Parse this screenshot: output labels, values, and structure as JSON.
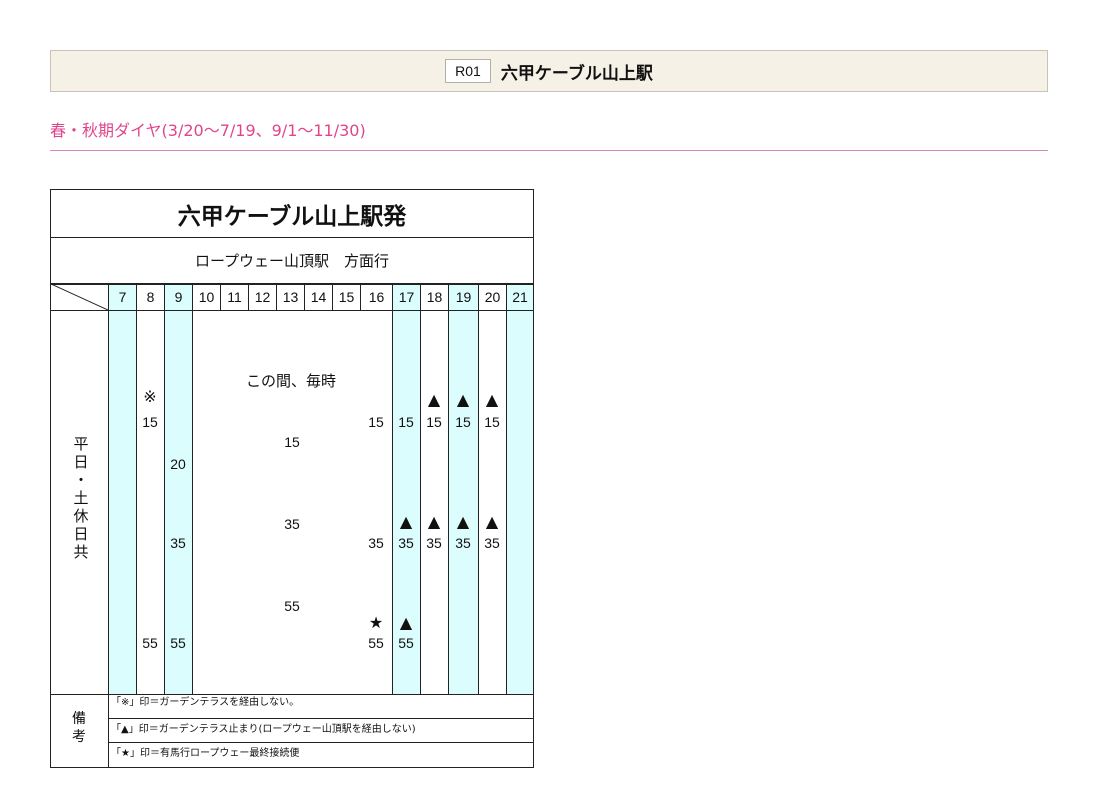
{
  "header": {
    "station_code": "R01",
    "station_name": "六甲ケーブル山上駅"
  },
  "season_label": "春・秋期ダイヤ(3/20〜7/19、9/1〜11/30)",
  "timetable": {
    "title": "六甲ケーブル山上駅発",
    "direction": "ロープウェー山頂駅　方面行",
    "row_label": "平\n日\n・\n土\n休\n日\n共",
    "every_hour_text": "この間、毎時",
    "hours": [
      "7",
      "8",
      "9",
      "10",
      "11",
      "12",
      "13",
      "14",
      "15",
      "16",
      "17",
      "18",
      "19",
      "20",
      "21"
    ],
    "highlight_color": "#dcfdfd",
    "highlighted_hours": [
      "7",
      "9",
      "17",
      "19",
      "21"
    ],
    "departures": {
      "8": [
        {
          "mark": "※",
          "min": "15"
        },
        {
          "mark": "",
          "min": "55"
        }
      ],
      "9": [
        {
          "mark": "",
          "min": "20"
        },
        {
          "mark": "",
          "min": "35"
        },
        {
          "mark": "",
          "min": "55"
        }
      ],
      "10-15": [
        "15",
        "35",
        "55"
      ],
      "16": [
        {
          "mark": "",
          "min": "15"
        },
        {
          "mark": "",
          "min": "35"
        },
        {
          "mark": "★",
          "min": "55"
        }
      ],
      "17": [
        {
          "mark": "",
          "min": "15"
        },
        {
          "mark": "▲",
          "min": "35"
        },
        {
          "mark": "▲",
          "min": "55"
        }
      ],
      "18": [
        {
          "mark": "▲",
          "min": "15"
        },
        {
          "mark": "▲",
          "min": "35"
        }
      ],
      "19": [
        {
          "mark": "▲",
          "min": "15"
        },
        {
          "mark": "▲",
          "min": "35"
        }
      ],
      "20": [
        {
          "mark": "▲",
          "min": "15"
        },
        {
          "mark": "▲",
          "min": "35"
        }
      ]
    },
    "notes_label": "備\n考",
    "notes": [
      "「※」印＝ガーデンテラスを経由しない。",
      "「▲」印＝ガーデンテラス止まり(ロープウェー山頂駅を経由しない)",
      "「★」印＝有馬行ロープウェー最終接続便"
    ]
  }
}
